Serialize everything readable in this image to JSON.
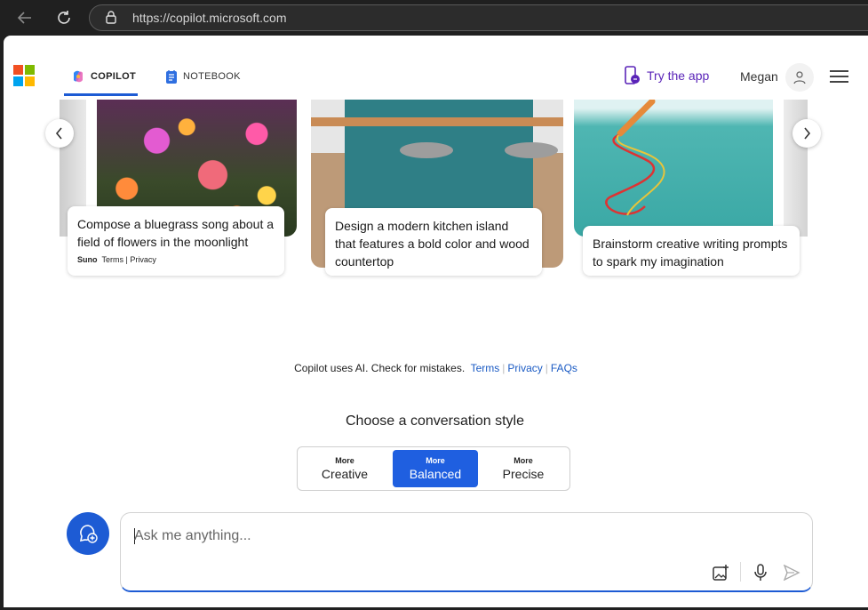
{
  "browser": {
    "url": "https://copilot.microsoft.com"
  },
  "header": {
    "tabs": [
      {
        "label": "COPILOT",
        "active": true
      },
      {
        "label": "NOTEBOOK",
        "active": false
      }
    ],
    "try_app": "Try the app",
    "user_name": "Megan"
  },
  "carousel": {
    "cards": [
      {
        "text": "Compose a bluegrass song about a field of flowers in the moonlight",
        "attribution_brand": "Suno",
        "attribution_links": "Terms | Privacy"
      },
      {
        "text": "Design a modern kitchen island that features a bold color and wood countertop"
      },
      {
        "text": "Brainstorm creative writing prompts to spark my imagination"
      }
    ]
  },
  "disclaimer": {
    "text": "Copilot uses AI. Check for mistakes.",
    "links": [
      "Terms",
      "Privacy",
      "FAQs"
    ]
  },
  "conversation_style": {
    "title": "Choose a conversation style",
    "options": [
      {
        "small": "More",
        "big": "Creative",
        "selected": false
      },
      {
        "small": "More",
        "big": "Balanced",
        "selected": true
      },
      {
        "small": "More",
        "big": "Precise",
        "selected": false
      }
    ]
  },
  "composer": {
    "placeholder": "Ask me anything..."
  },
  "colors": {
    "accent": "#1d5bd4",
    "balanced_bg": "#1f5fe0",
    "try_app": "#5a24b8",
    "link": "#1b5bc4"
  }
}
